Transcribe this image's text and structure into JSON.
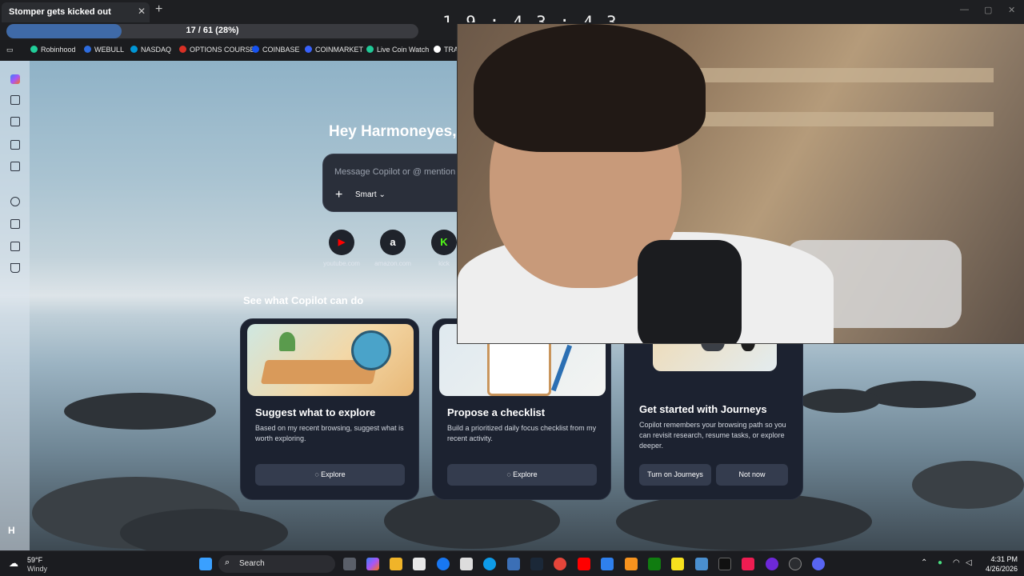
{
  "tab": {
    "title": "Stomper gets kicked out",
    "close": "✕",
    "new": "+"
  },
  "overlay_clock": "1 9 : 4 3 : 4 3",
  "progress": {
    "text": "17 / 61 (28%)",
    "fraction": 0.28
  },
  "bookmarks": [
    {
      "label": "Robinhood",
      "color": "#21ce99"
    },
    {
      "label": "WEBULL",
      "color": "#2d6cdf"
    },
    {
      "label": "NASDAQ",
      "color": "#0096d6"
    },
    {
      "label": "OPTIONS COURSE",
      "color": "#d93025"
    },
    {
      "label": "COINBASE",
      "color": "#1652f0"
    },
    {
      "label": "COINMARKET",
      "color": "#3861fb"
    },
    {
      "label": "Live Coin Watch",
      "color": "#20c997"
    },
    {
      "label": "TRA",
      "color": "#ffffff"
    }
  ],
  "sidebar": {
    "avatar": "H"
  },
  "copilot": {
    "greeting": "Hey Harmoneyes, w",
    "input_placeholder": "Message Copilot or @ mention a",
    "mode": "Smart ⌄",
    "plus": "+",
    "shortcuts": [
      {
        "label": "youtube.com",
        "glyph": "▶",
        "color": "#ff0000"
      },
      {
        "label": "amazon.com",
        "glyph": "a",
        "color": "#ffffff"
      },
      {
        "label": "kick",
        "glyph": "K",
        "color": "#53fc18"
      }
    ],
    "section_title": "See what Copilot can do",
    "cards": [
      {
        "title": "Suggest what to explore",
        "desc": "Based on my recent browsing, suggest what is worth exploring.",
        "button": "Explore"
      },
      {
        "title": "Propose a checklist",
        "desc": "Build a prioritized daily focus checklist from my recent activity.",
        "button": "Explore"
      },
      {
        "title": "Get started with Journeys",
        "desc": "Copilot remembers your browsing path so you can revisit research, resume tasks, or explore deeper.",
        "button_primary": "Turn on Journeys",
        "button_secondary": "Not now"
      }
    ]
  },
  "taskbar": {
    "weather_temp": "59°F",
    "weather_desc": "Windy",
    "search": "Search",
    "time": "4:31 PM",
    "date": "4/26/2026"
  }
}
